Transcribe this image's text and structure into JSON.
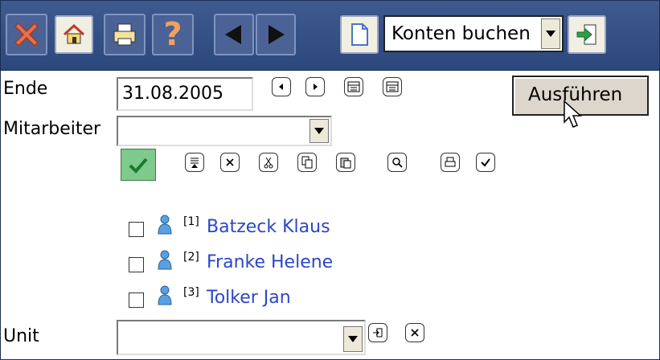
{
  "toolbar": {
    "icons": [
      "close-icon",
      "home-icon",
      "print-icon",
      "help-icon",
      "back-icon",
      "forward-icon",
      "document-icon",
      "go-icon"
    ],
    "action_select": {
      "value": "Konten buchen"
    }
  },
  "form": {
    "ende_label": "Ende",
    "ende_value": "31.08.2005",
    "mitarbeiter_label": "Mitarbeiter",
    "mitarbeiter_value": "",
    "unit_label": "Unit",
    "unit_value": "",
    "run_button": "Ausführen"
  },
  "employees": [
    {
      "index": "[1]",
      "name": "Batzeck Klaus"
    },
    {
      "index": "[2]",
      "name": "Franke Helene"
    },
    {
      "index": "[3]",
      "name": "Tolker Jan"
    }
  ],
  "colors": {
    "toolbar_bg": "#34508a",
    "link": "#2c46c8",
    "ok_green": "#7ec98c"
  }
}
